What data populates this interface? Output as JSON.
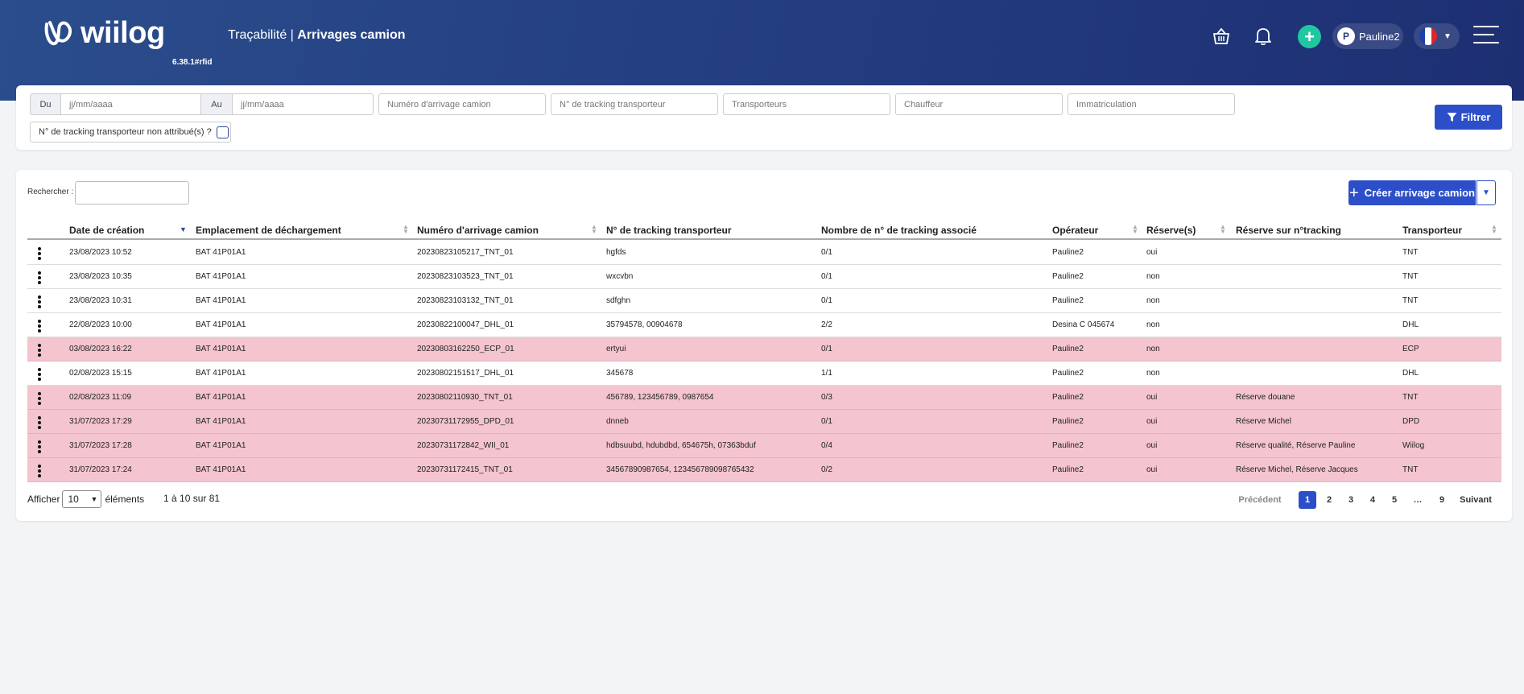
{
  "header": {
    "logo_text": "wiilog",
    "version": "6.38.1#rfid",
    "title_section": "Traçabilité |",
    "title_page": "Arrivages camion",
    "user_initial": "P",
    "user_name": "Pauline2",
    "flag_colors": [
      "#1f3fa8",
      "#ffffff",
      "#e0242c"
    ],
    "add_symbol": "+"
  },
  "filters": {
    "du_label": "Du",
    "au_label": "Au",
    "date_from_placeholder": "jj/mm/aaaa",
    "date_to_placeholder": "jj/mm/aaaa",
    "arrival_number_placeholder": "Numéro d'arrivage camion",
    "tracking_placeholder": "N° de tracking transporteur",
    "carriers_placeholder": "Transporteurs",
    "driver_placeholder": "Chauffeur",
    "plate_placeholder": "Immatriculation",
    "unassigned_label": "N° de tracking transporteur non attribué(s) ?",
    "filter_button": "Filtrer"
  },
  "table": {
    "search_label": "Rechercher :",
    "create_button": "Créer arrivage camion",
    "create_plus": "+",
    "columns": [
      "Date de création",
      "Emplacement de déchargement",
      "Numéro d'arrivage camion",
      "N° de tracking transporteur",
      "Nombre de n° de tracking associé",
      "Opérateur",
      "Réserve(s)",
      "Réserve sur n°tracking",
      "Transporteur"
    ],
    "rows": [
      {
        "date": "23/08/2023 10:52",
        "location": "BAT 41P01A1",
        "number": "20230823105217_TNT_01",
        "tracking": "hgfds",
        "count": "0/1",
        "operator": "Pauline2",
        "reserve": "oui",
        "reserve_tracking": "",
        "carrier": "TNT",
        "highlight": false
      },
      {
        "date": "23/08/2023 10:35",
        "location": "BAT 41P01A1",
        "number": "20230823103523_TNT_01",
        "tracking": "wxcvbn",
        "count": "0/1",
        "operator": "Pauline2",
        "reserve": "non",
        "reserve_tracking": "",
        "carrier": "TNT",
        "highlight": false
      },
      {
        "date": "23/08/2023 10:31",
        "location": "BAT 41P01A1",
        "number": "20230823103132_TNT_01",
        "tracking": "sdfghn",
        "count": "0/1",
        "operator": "Pauline2",
        "reserve": "non",
        "reserve_tracking": "",
        "carrier": "TNT",
        "highlight": false
      },
      {
        "date": "22/08/2023 10:00",
        "location": "BAT 41P01A1",
        "number": "20230822100047_DHL_01",
        "tracking": "35794578, 00904678",
        "count": "2/2",
        "operator": "Desina C 045674",
        "reserve": "non",
        "reserve_tracking": "",
        "carrier": "DHL",
        "highlight": false
      },
      {
        "date": "03/08/2023 16:22",
        "location": "BAT 41P01A1",
        "number": "20230803162250_ECP_01",
        "tracking": "ertyui",
        "count": "0/1",
        "operator": "Pauline2",
        "reserve": "non",
        "reserve_tracking": "",
        "carrier": "ECP",
        "highlight": true
      },
      {
        "date": "02/08/2023 15:15",
        "location": "BAT 41P01A1",
        "number": "20230802151517_DHL_01",
        "tracking": "345678",
        "count": "1/1",
        "operator": "Pauline2",
        "reserve": "non",
        "reserve_tracking": "",
        "carrier": "DHL",
        "highlight": false
      },
      {
        "date": "02/08/2023 11:09",
        "location": "BAT 41P01A1",
        "number": "20230802110930_TNT_01",
        "tracking": "456789, 123456789, 0987654",
        "count": "0/3",
        "operator": "Pauline2",
        "reserve": "oui",
        "reserve_tracking": "Réserve douane",
        "carrier": "TNT",
        "highlight": true
      },
      {
        "date": "31/07/2023 17:29",
        "location": "BAT 41P01A1",
        "number": "20230731172955_DPD_01",
        "tracking": "dnneb",
        "count": "0/1",
        "operator": "Pauline2",
        "reserve": "oui",
        "reserve_tracking": "Réserve Michel",
        "carrier": "DPD",
        "highlight": true
      },
      {
        "date": "31/07/2023 17:28",
        "location": "BAT 41P01A1",
        "number": "20230731172842_WII_01",
        "tracking": "hdbsuubd, hdubdbd, 654675h, 07363bduf",
        "count": "0/4",
        "operator": "Pauline2",
        "reserve": "oui",
        "reserve_tracking": "Réserve qualité, Réserve Pauline",
        "carrier": "Wiilog",
        "highlight": true
      },
      {
        "date": "31/07/2023 17:24",
        "location": "BAT 41P01A1",
        "number": "20230731172415_TNT_01",
        "tracking": "34567890987654, 123456789098765432",
        "count": "0/2",
        "operator": "Pauline2",
        "reserve": "oui",
        "reserve_tracking": "Réserve Michel, Réserve Jacques",
        "carrier": "TNT",
        "highlight": true
      }
    ],
    "highlight_color": "#f4c4cf",
    "show_label": "Afficher",
    "show_value": "10",
    "show_suffix": "éléments",
    "info": "1 à 10 sur 81",
    "pagination": {
      "previous": "Précédent",
      "pages": [
        "1",
        "2",
        "3",
        "4",
        "5",
        "…",
        "9"
      ],
      "active": "1",
      "next": "Suivant"
    }
  },
  "colors": {
    "accent": "#2c4fc9",
    "add_green": "#1fc8a0",
    "header_dark": "#1d2f72"
  }
}
